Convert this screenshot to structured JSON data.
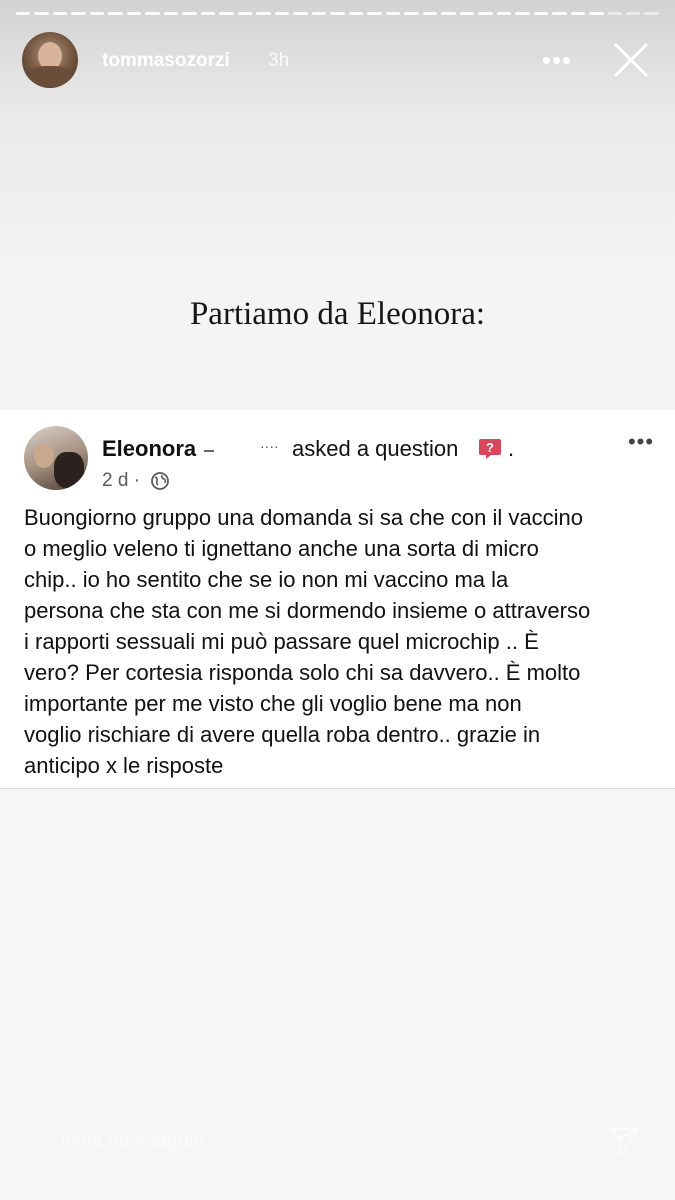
{
  "story": {
    "username": "tommasozorzi",
    "time": "3h",
    "more_label": "•••",
    "title": "Partiamo da Eleonora:"
  },
  "post": {
    "author": "Eleonora",
    "action": "asked a question",
    "trailing_dot": ".",
    "more_label": "•••",
    "meta_time": "2 d ·",
    "body": "Buongiorno gruppo una domanda si sa che con il vaccino\no meglio veleno ti  ignettano anche una sorta di micro\nchip.. io ho sentito che se io non mi vaccino ma la\npersona che sta con me si dormendo insieme o attraverso\ni rapporti sessuali mi può passare quel microchip .. È\nvero? Per cortesia risponda solo chi sa davvero.. È molto\nimportante  per me visto che gli voglio bene ma non\nvoglio rischiare di avere quella roba dentro.. grazie in\nanticipo x le risposte"
  },
  "footer": {
    "send_placeholder": "Invia messaggio"
  },
  "colors": {
    "question_badge": "#d9475b",
    "meta_gray": "#5a5a5a"
  },
  "icons": [
    "close-icon",
    "more-icon",
    "question-icon",
    "globe-icon",
    "share-icon"
  ]
}
